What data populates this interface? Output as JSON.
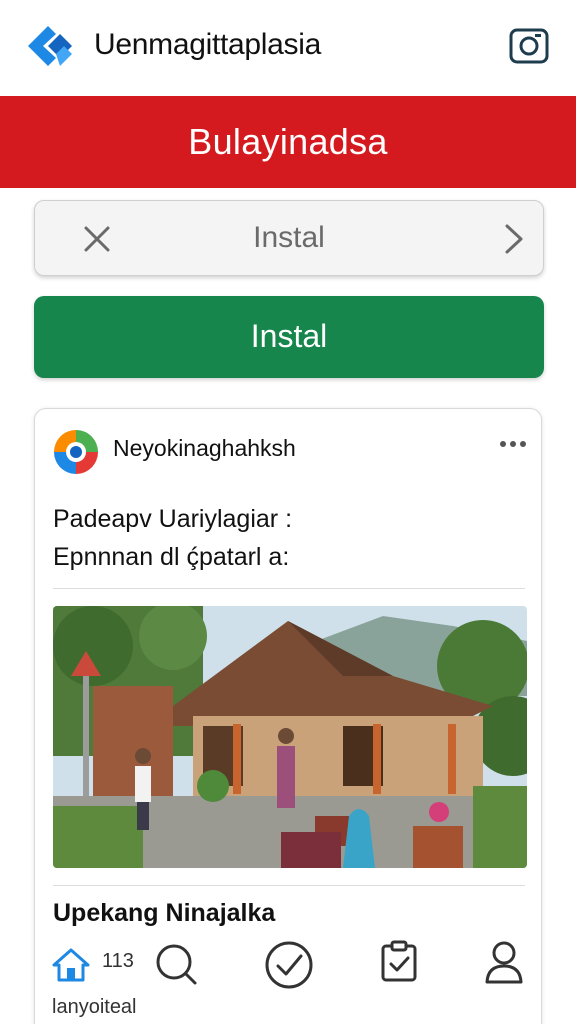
{
  "header": {
    "app_title": "Uenmagittaplasia",
    "logo_icon": "app-logo-icon",
    "camera_icon": "camera-icon"
  },
  "banner": {
    "text": "Bulayinadsa",
    "color": "#d41a1f"
  },
  "buttons": {
    "outline_label": "Instal",
    "primary_label": "Instal",
    "primary_color": "#17864d"
  },
  "post": {
    "author": "Neyokinaghahksh",
    "line1": "Padeapv Uariylagiar :",
    "line2": "Epnnnan dl ḉpatarl a:",
    "title": "Upekang Ninajalka",
    "more_icon": "more-icon"
  },
  "bottom_nav": {
    "home_count": "113",
    "footer_text": "lanyoiteal",
    "icons": [
      "home-icon",
      "search-icon",
      "check-circle-icon",
      "clipboard-check-icon",
      "user-icon"
    ]
  }
}
